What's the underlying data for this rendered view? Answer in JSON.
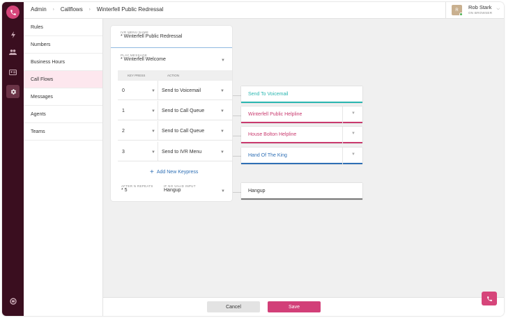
{
  "breadcrumbs": [
    "Admin",
    "Callflows",
    "Winterfell Public Redressal"
  ],
  "user": {
    "initial": "R",
    "name": "Rob Stark",
    "status": "ON BROWSER"
  },
  "sidebar": {
    "items": [
      {
        "label": "Rules"
      },
      {
        "label": "Numbers"
      },
      {
        "label": "Business Hours"
      },
      {
        "label": "Call Flows"
      },
      {
        "label": "Messages"
      },
      {
        "label": "Agents"
      },
      {
        "label": "Teams"
      }
    ],
    "active": "Call Flows"
  },
  "form": {
    "ivr_name_label": "IVR MENU NAME",
    "ivr_name_value": "Winterfell Public Redressal",
    "play_label": "PLAY MESSAGE",
    "play_value": "Winterfell Welcome",
    "col_key": "KEY PRESS",
    "col_action": "ACTION",
    "rows": [
      {
        "key": "0",
        "action": "Send to Voicemail",
        "destination": "Send To Voicemail",
        "dest_color": "#29b6b0"
      },
      {
        "key": "1",
        "action": "Send to Call Queue",
        "destination": "Winterfell Public Helpline",
        "dest_color": "#c93a6e"
      },
      {
        "key": "2",
        "action": "Send to Call Queue",
        "destination": "House Bolton Helpline",
        "dest_color": "#c93a6e"
      },
      {
        "key": "3",
        "action": "Send to IVR Menu",
        "destination": "Hand Of The King",
        "dest_color": "#2e6fb5"
      }
    ],
    "add_keypress": "Add New Keypress",
    "repeats_label": "AFTER N REPEATS",
    "repeats_value": "5",
    "novalid_label": "IF NO VALID INPUT",
    "novalid_value": "Hangup",
    "novalid_destination": "Hangup"
  },
  "footer": {
    "cancel": "Cancel",
    "save": "Save"
  },
  "colors": {
    "rail": "#3a0e1f",
    "brand": "#d6457a",
    "save": "#d23f78"
  }
}
